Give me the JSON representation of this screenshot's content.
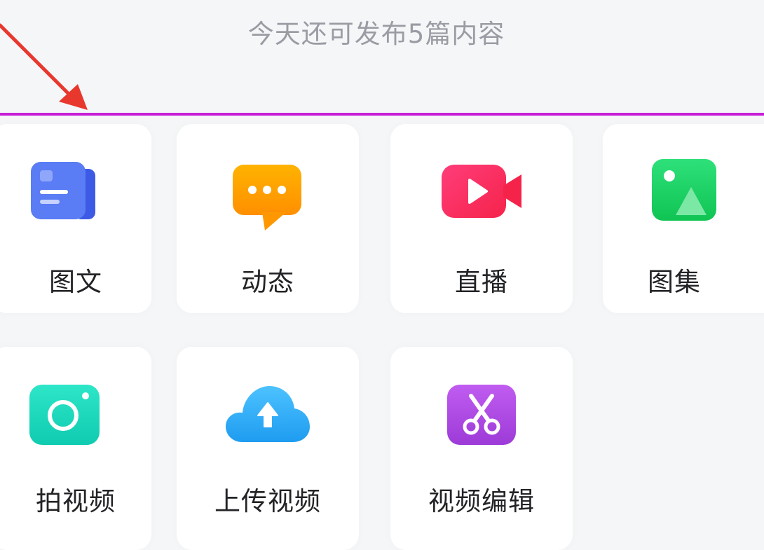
{
  "header": {
    "quota_text": "今天还可发布5篇内容"
  },
  "colors": {
    "divider": "#c81fd6",
    "annotation_arrow": "#e8382e",
    "background": "#f5f6f8"
  },
  "options": [
    {
      "label": "图文",
      "icon": "article-icon",
      "color": "#4a6cf0"
    },
    {
      "label": "动态",
      "icon": "chat-bubble-icon",
      "color": "#ffaa00"
    },
    {
      "label": "直播",
      "icon": "video-camera-icon",
      "color": "#fb2d63"
    },
    {
      "label": "图集",
      "icon": "image-gallery-icon",
      "color": "#18d35e"
    },
    {
      "label": "拍视频",
      "icon": "camera-icon",
      "color": "#15d6bc"
    },
    {
      "label": "上传视频",
      "icon": "cloud-upload-icon",
      "color": "#2fa6f4"
    },
    {
      "label": "视频编辑",
      "icon": "scissors-icon",
      "color": "#b04de2"
    }
  ]
}
